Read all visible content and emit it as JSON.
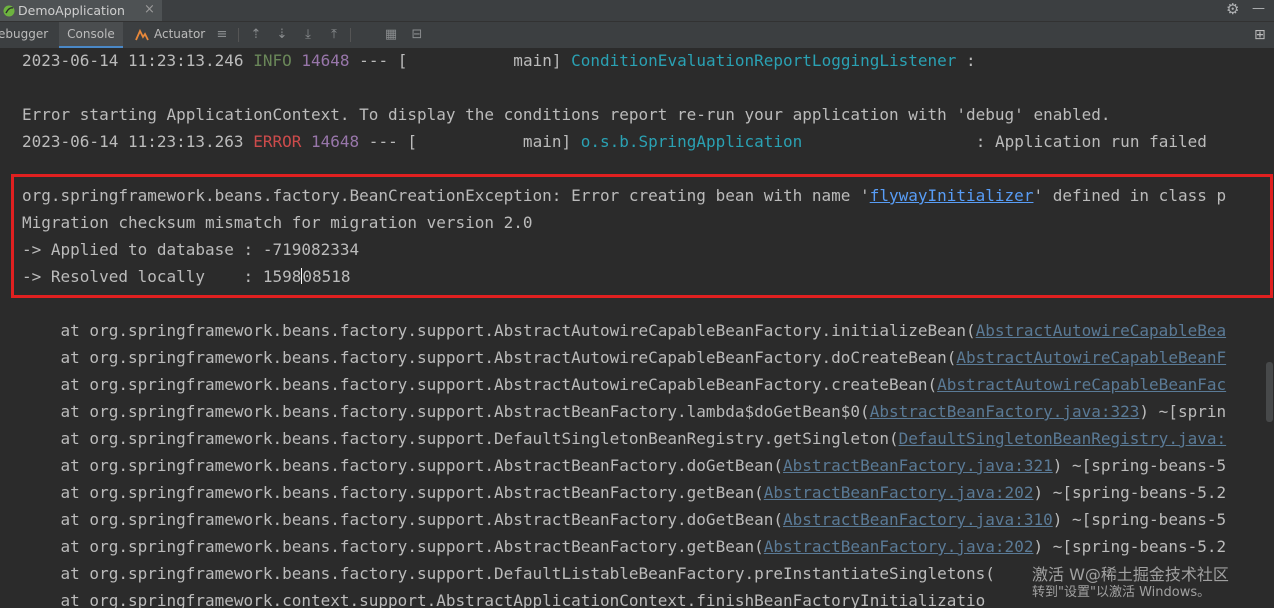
{
  "run_tab": {
    "title": "DemoApplication",
    "close": "×"
  },
  "header_icons": {
    "settings": "⚙",
    "hide": "—"
  },
  "toolbar": {
    "tabs": {
      "debugger": "ebugger",
      "console": "Console",
      "actuator": "Actuator"
    },
    "buttons": {
      "menu": "≡",
      "up": "⇡",
      "down": "⇣",
      "down2": "⤓",
      "up2": "⤒",
      "grid": "▦",
      "clear": "⊟",
      "layout": "⊞"
    }
  },
  "console": {
    "line1": {
      "timestamp": "2023-06-14 11:23:13.246",
      "level": " INFO",
      "pid": "14648",
      "sep": " --- [           main] ",
      "logger": "ConditionEvaluationReportLoggingListener",
      "tail": " :"
    },
    "line2": "Error starting ApplicationContext. To display the conditions report re-run your application with 'debug' enabled.",
    "line3": {
      "timestamp": "2023-06-14 11:23:13.263",
      "level": " ERROR",
      "pid": "14648",
      "sep": " --- [           main] ",
      "logger": "o.s.b.SpringApplication",
      "tail": "                  : Application run failed"
    },
    "exception": {
      "prefix": "org.springframework.beans.factory.BeanCreationException: Error creating bean with name '",
      "bean": "flywayInitializer",
      "suffix": "' defined in class p",
      "line2": "Migration checksum mismatch for migration version 2.0",
      "line3": "-> Applied to database : -719082334",
      "line4a": "-> Resolved locally    : 1598",
      "line4b": "08518"
    },
    "stack": [
      {
        "text": "    at org.springframework.beans.factory.support.AbstractAutowireCapableBeanFactory.initializeBean(",
        "link": "AbstractAutowireCapableBea",
        "rest": ""
      },
      {
        "text": "    at org.springframework.beans.factory.support.AbstractAutowireCapableBeanFactory.doCreateBean(",
        "link": "AbstractAutowireCapableBeanF",
        "rest": ""
      },
      {
        "text": "    at org.springframework.beans.factory.support.AbstractAutowireCapableBeanFactory.createBean(",
        "link": "AbstractAutowireCapableBeanFac",
        "rest": ""
      },
      {
        "text": "    at org.springframework.beans.factory.support.AbstractBeanFactory.lambda$doGetBean$0(",
        "link": "AbstractBeanFactory.java:323",
        "rest": ") ~[sprin"
      },
      {
        "text": "    at org.springframework.beans.factory.support.DefaultSingletonBeanRegistry.getSingleton(",
        "link": "DefaultSingletonBeanRegistry.java:",
        "rest": ""
      },
      {
        "text": "    at org.springframework.beans.factory.support.AbstractBeanFactory.doGetBean(",
        "link": "AbstractBeanFactory.java:321",
        "rest": ") ~[spring-beans-5"
      },
      {
        "text": "    at org.springframework.beans.factory.support.AbstractBeanFactory.getBean(",
        "link": "AbstractBeanFactory.java:202",
        "rest": ") ~[spring-beans-5.2"
      },
      {
        "text": "    at org.springframework.beans.factory.support.AbstractBeanFactory.doGetBean(",
        "link": "AbstractBeanFactory.java:310",
        "rest": ") ~[spring-beans-5"
      },
      {
        "text": "    at org.springframework.beans.factory.support.AbstractBeanFactory.getBean(",
        "link": "AbstractBeanFactory.java:202",
        "rest": ") ~[spring-beans-5.2"
      },
      {
        "text": "    at org.springframework.beans.factory.support.DefaultListableBeanFactory.preInstantiateSingletons(",
        "link": "",
        "rest": ""
      },
      {
        "text": "    at org.springframework.context.support.AbstractApplicationContext.finishBeanFactoryInitializatio",
        "link": "",
        "rest": ""
      }
    ]
  },
  "watermark": {
    "line1": "激活 W@稀土掘金技术社区",
    "line2": "转到\"设置\"以激活 Windows。"
  },
  "colors": {
    "info": "#6a8759",
    "error": "#cc4b4b",
    "pid": "#9876aa",
    "logger": "#2aa1b3",
    "highlight": "#e02020"
  }
}
